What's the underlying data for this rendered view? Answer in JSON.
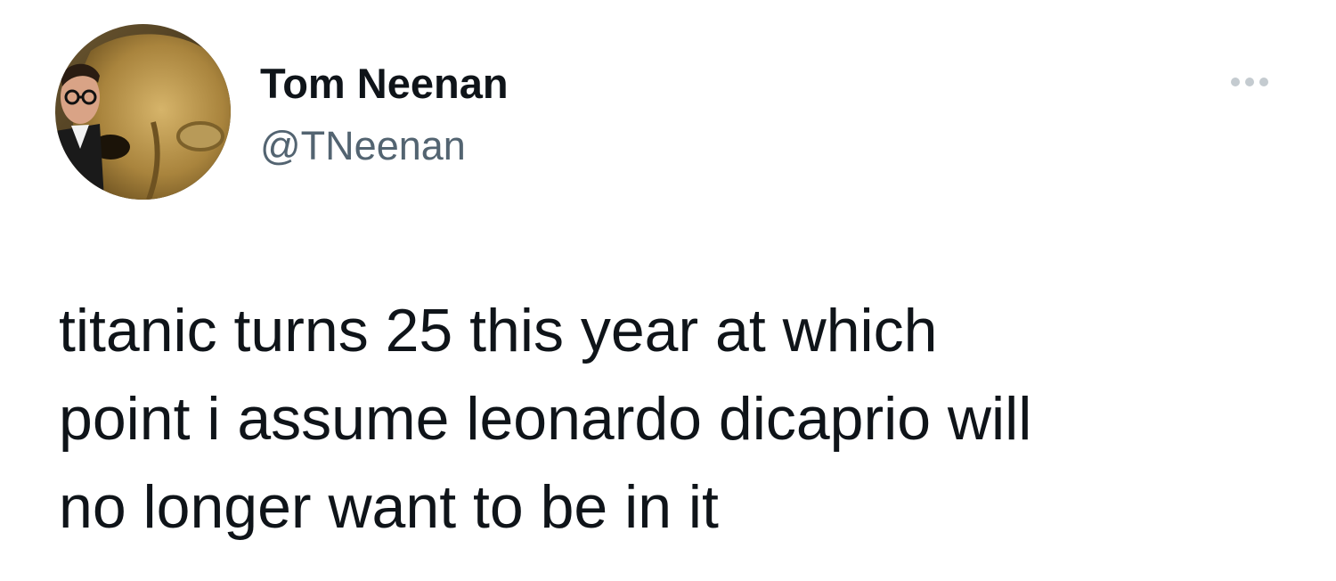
{
  "author": {
    "display_name": "Tom Neenan",
    "handle": "@TNeenan",
    "avatar": "profile-photo"
  },
  "more_icon": "more-options-icon",
  "tweet": {
    "lines": [
      "titanic turns 25 this year at which",
      "point i assume leonardo dicaprio will",
      "no longer want to be in it"
    ]
  },
  "colors": {
    "text": "#0f1419",
    "secondary_text": "#536471",
    "background": "#ffffff",
    "icon": "#c4cbd0"
  }
}
